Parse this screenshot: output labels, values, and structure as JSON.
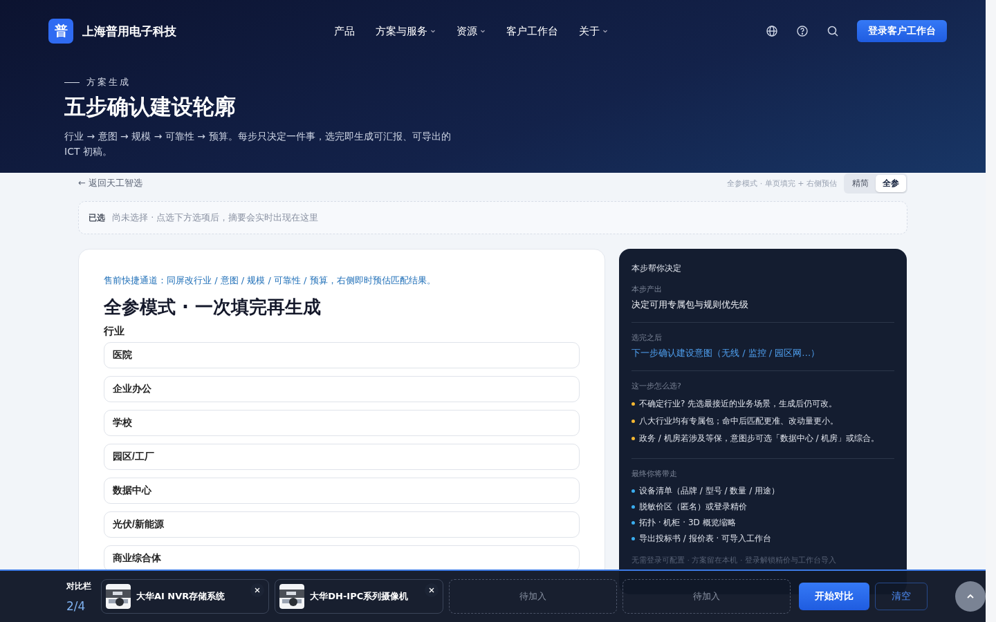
{
  "brand": {
    "logo": "普",
    "name": "上海普用电子科技"
  },
  "nav": [
    {
      "label": "产品",
      "dropdown": false
    },
    {
      "label": "方案与服务",
      "dropdown": true
    },
    {
      "label": "资源",
      "dropdown": true
    },
    {
      "label": "客户工作台",
      "dropdown": false
    },
    {
      "label": "关于",
      "dropdown": true
    }
  ],
  "login_button": "登录客户工作台",
  "hero": {
    "eyebrow": "方案生成",
    "title": "五步确认建设轮廓",
    "description": "行业 → 意图 → 规模 → 可靠性 → 预算。每步只决定一件事，选完即生成可汇报、可导出的 ICT 初稿。"
  },
  "back_link": "← 返回天工智选",
  "mode_hint": "全参模式 · 单页填完 + 右侧预估",
  "mode_toggle": [
    {
      "label": "精简",
      "selected": false
    },
    {
      "label": "全参",
      "selected": true
    }
  ],
  "summary": {
    "label": "已选",
    "text": "尚未选择 · 点选下方选项后，摘要会实时出现在这里"
  },
  "form": {
    "fast_track": "售前快捷通道：同屏改行业 / 意图 / 规模 / 可靠性 / 预算，右侧即时预估匹配结果。",
    "title": "全参模式 · 一次填完再生成",
    "section": "行业",
    "options": [
      {
        "label": "医院",
        "selected": false
      },
      {
        "label": "企业办公",
        "selected": false
      },
      {
        "label": "学校",
        "selected": false
      },
      {
        "label": "园区/工厂",
        "selected": false
      },
      {
        "label": "数据中心",
        "selected": false
      },
      {
        "label": "光伏/新能源",
        "selected": false
      },
      {
        "label": "商业综合体",
        "selected": false
      }
    ]
  },
  "guide": {
    "title": "本步帮你决定",
    "output_label": "本步产出",
    "output": "决定可用专属包与规则优先级",
    "next_label": "选完之后",
    "next": "下一步确认建设意图（无线 / 监控 / 园区网…）",
    "tips_label": "这一步怎么选?",
    "tips": [
      "不确定行业? 先选最接近的业务场景，生成后仍可改。",
      "八大行业均有专属包；命中后匹配更准、改动量更小。",
      "政务 / 机房若涉及等保，意图步可选「数据中心 / 机房」或综合。"
    ],
    "takeaway_label": "最终你将带走",
    "takeaways": [
      "设备清单（品牌 / 型号 / 数量 / 用途）",
      "脱敏价区（匿名）或登录精价",
      "拓扑 · 机柜 · 3D 概览缩略",
      "导出投标书 / 报价表 · 可导入工作台"
    ],
    "footnote": "无需登录可配置 · 方案留在本机 · 登录解锁精价与工作台导入"
  },
  "compare": {
    "label": "对比栏",
    "count": "2/4",
    "slots": [
      {
        "kind": "item",
        "name": "大华AI NVR存储系统"
      },
      {
        "kind": "item",
        "name": "大华DH-IPC系列摄像机"
      },
      {
        "kind": "empty",
        "name": "待加入"
      },
      {
        "kind": "empty",
        "name": "待加入"
      }
    ],
    "start": "开始对比",
    "clear": "清空"
  }
}
